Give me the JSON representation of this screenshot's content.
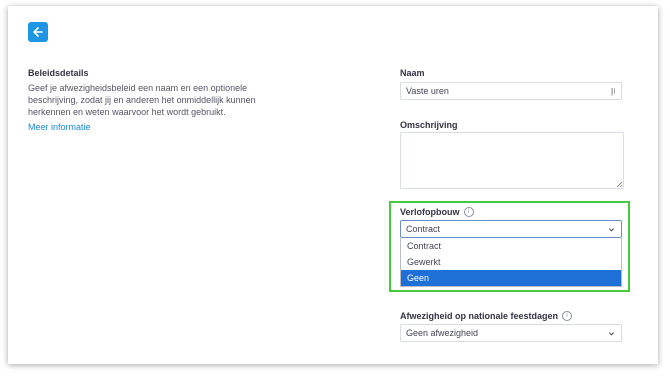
{
  "header": {
    "back_icon": "arrow-left-icon",
    "accent": "#1f95e6"
  },
  "policy_details": {
    "title": "Beleidsdetails",
    "description": "Geef je afwezigheidsbeleid een naam en een optionele beschrijving, zodat jij en anderen het onmiddellijk kunnen herkennen en weten waarvoor het wordt gebruikt.",
    "more_link": "Meer informatie"
  },
  "name_field": {
    "label": "Naam",
    "value": "Vaste uren"
  },
  "description_field": {
    "label": "Omschrijving",
    "value": ""
  },
  "accrual_field": {
    "label": "Verlofopbouw",
    "value": "Contract",
    "options": [
      "Contract",
      "Gewerkt",
      "Geen"
    ],
    "highlighted_option": "Geen",
    "highlight_color": "#46c93a"
  },
  "holiday_field": {
    "label": "Afwezigheid op nationale feestdagen",
    "value": "Geen afwezigheid"
  }
}
